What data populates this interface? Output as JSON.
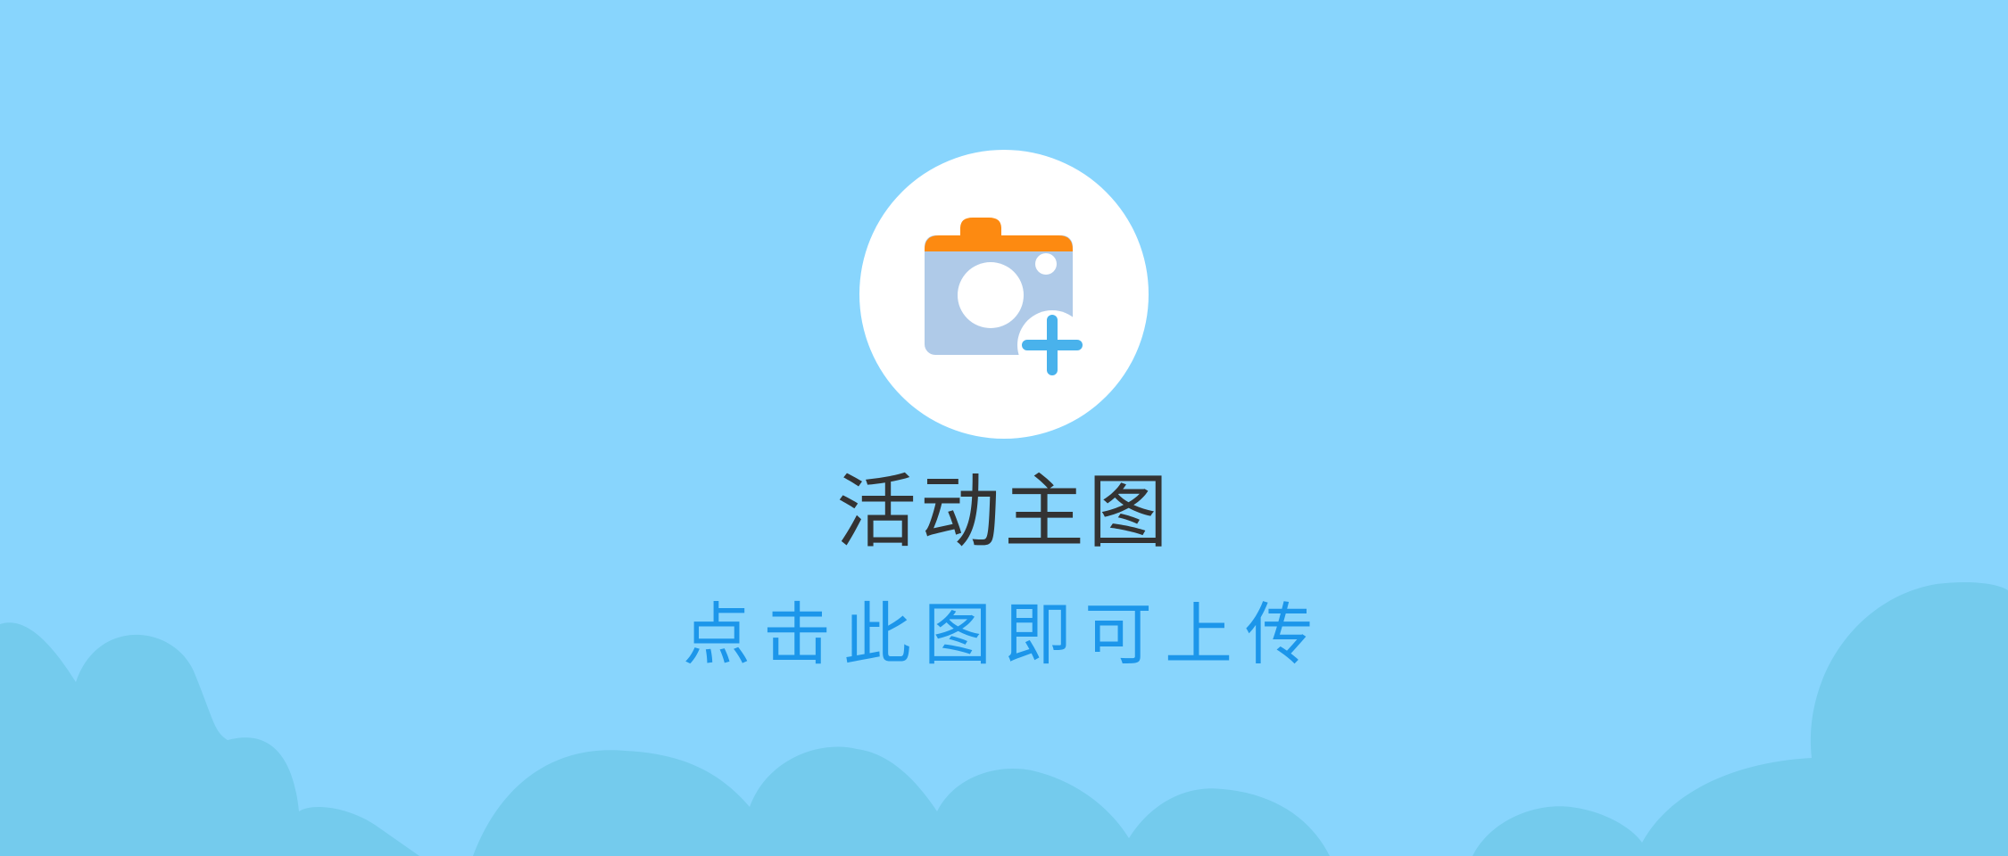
{
  "upload": {
    "title": "活动主图",
    "hint": "点击此图即可上传",
    "icon": "camera-add-icon"
  },
  "colors": {
    "background": "#88d5fd",
    "cloud": "#74cbed",
    "circle": "#ffffff",
    "camera_body": "#afcae8",
    "camera_top": "#fd8a11",
    "plus": "#49b2ec",
    "title_text": "#333333",
    "hint_text": "#1c96ea"
  }
}
